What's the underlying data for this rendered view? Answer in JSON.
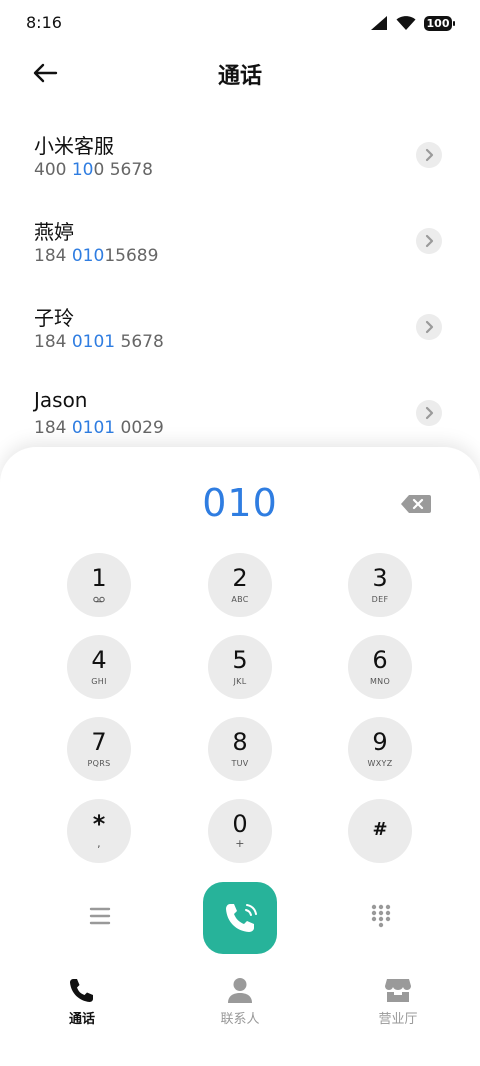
{
  "status_bar": {
    "time": "8:16",
    "battery": "100"
  },
  "header": {
    "title": "通话"
  },
  "contacts": [
    {
      "name": "小米客服",
      "number_parts": [
        "400 ",
        "10",
        "0 5678"
      ]
    },
    {
      "name": "燕婷",
      "number_parts": [
        "184 ",
        "010",
        "15689"
      ]
    },
    {
      "name": "子玲",
      "number_parts": [
        "184 ",
        "0101",
        " 5678"
      ]
    },
    {
      "name": "Jason",
      "number_parts": [
        "184 ",
        "0101",
        " 0029"
      ]
    }
  ],
  "dialer": {
    "input": "010",
    "keys": [
      {
        "digit": "1",
        "sub": ""
      },
      {
        "digit": "2",
        "sub": "ABC"
      },
      {
        "digit": "3",
        "sub": "DEF"
      },
      {
        "digit": "4",
        "sub": "GHI"
      },
      {
        "digit": "5",
        "sub": "JKL"
      },
      {
        "digit": "6",
        "sub": "MNO"
      },
      {
        "digit": "7",
        "sub": "PQRS"
      },
      {
        "digit": "8",
        "sub": "TUV"
      },
      {
        "digit": "9",
        "sub": "WXYZ"
      },
      {
        "digit": "*",
        "sub": ","
      },
      {
        "digit": "0",
        "sub": "+"
      },
      {
        "digit": "#",
        "sub": ""
      }
    ]
  },
  "bottom_nav": {
    "items": [
      {
        "label": "通话",
        "icon": "phone-icon",
        "active": true
      },
      {
        "label": "联系人",
        "icon": "person-icon",
        "active": false
      },
      {
        "label": "营业厅",
        "icon": "store-icon",
        "active": false
      }
    ]
  },
  "colors": {
    "accent": "#2f7de1",
    "call": "#27b39a",
    "key_bg": "#ebebeb"
  }
}
